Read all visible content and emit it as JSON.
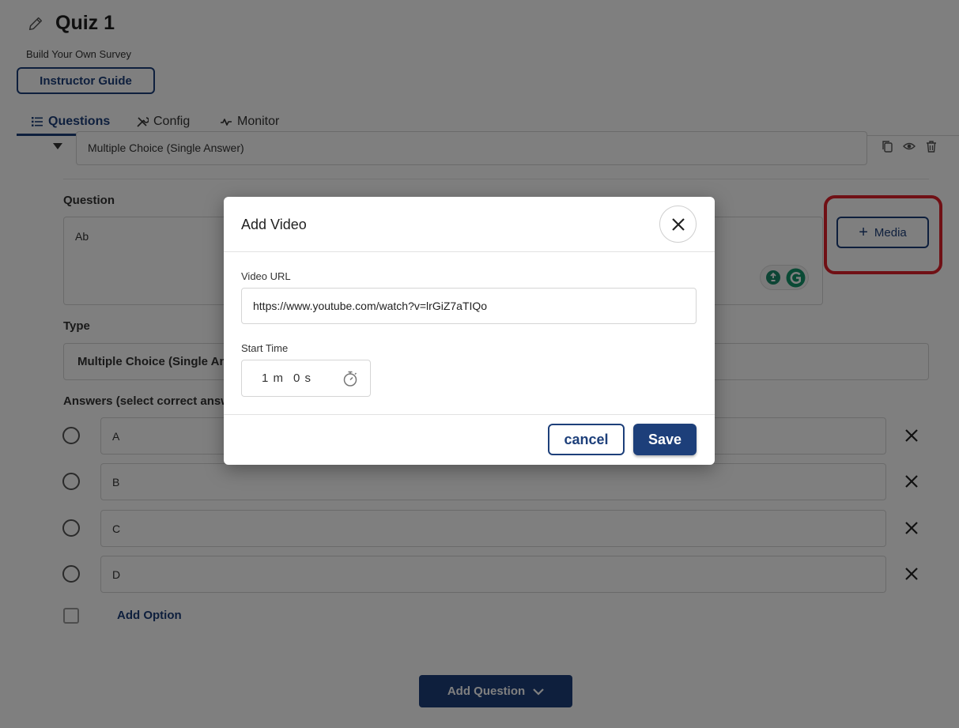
{
  "page": {
    "title": "Quiz 1",
    "subtitle": "Build Your Own Survey",
    "instructor_guide_label": "Instructor Guide"
  },
  "tabs": [
    {
      "label": "Questions",
      "icon": "list-icon",
      "active": true
    },
    {
      "label": "Config",
      "icon": "tools-icon",
      "active": false
    },
    {
      "label": "Monitor",
      "icon": "pulse-icon",
      "active": false
    }
  ],
  "question_card": {
    "header_type_value": "Multiple Choice (Single Answer)",
    "question_label": "Question",
    "question_text": "Ab",
    "media_button_label": "Media",
    "type_label": "Type",
    "type_value": "Multiple Choice (Single Answer)",
    "answers_label": "Answers (select correct answer)",
    "answers": [
      "A",
      "B",
      "C",
      "D"
    ],
    "add_option_label": "Add Option"
  },
  "add_question_label": "Add Question",
  "modal": {
    "title": "Add Video",
    "video_url_label": "Video URL",
    "video_url_value": "https://www.youtube.com/watch?v=lrGiZ7aTIQo",
    "start_time_label": "Start Time",
    "start_minutes": "1 m",
    "start_seconds": "0 s",
    "cancel_label": "cancel",
    "save_label": "Save"
  },
  "colors": {
    "brand": "#1d3f7a",
    "highlight": "#e0202a",
    "overlay": "rgba(0,0,0,0.5)"
  }
}
